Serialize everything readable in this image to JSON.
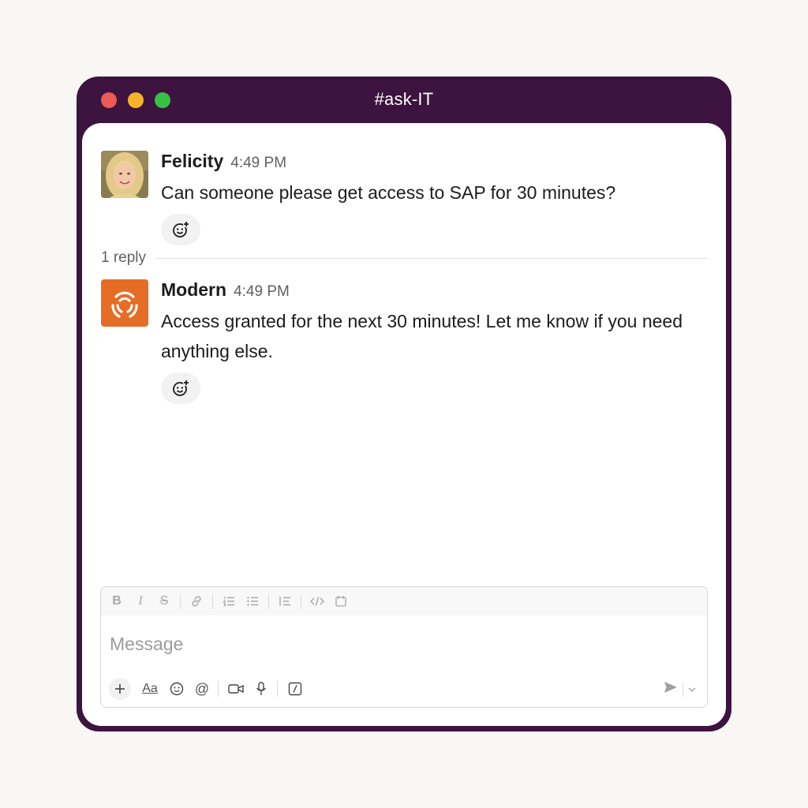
{
  "window": {
    "title": "#ask-IT",
    "colors": {
      "frame": "#3d133f",
      "close": "#ee5a55",
      "minimize": "#f6b42b",
      "maximize": "#37c046"
    }
  },
  "messages": [
    {
      "author": "Felicity",
      "time": "4:49 PM",
      "text": "Can someone please get access to SAP for 30 minutes?",
      "avatar": "felicity-photo"
    },
    {
      "author": "Modern",
      "time": "4:49 PM",
      "text": "Access granted for the next 30 minutes! Let me know if you need anything else.",
      "avatar": "modern-logo",
      "avatar_color": "#e56d25"
    }
  ],
  "thread": {
    "reply_count_label": "1 reply"
  },
  "composer": {
    "placeholder": "Message",
    "format_toolbar": [
      "bold-icon",
      "italic-icon",
      "strikethrough-icon",
      "link-icon",
      "ordered-list-icon",
      "bulleted-list-icon",
      "blockquote-icon",
      "code-icon",
      "code-block-icon"
    ],
    "format_labels": {
      "bold": "B",
      "italic": "I",
      "strike": "S"
    },
    "bottom_toolbar": [
      "plus-icon",
      "text-format-icon",
      "emoji-icon",
      "mention-icon",
      "video-icon",
      "microphone-icon",
      "slash-command-icon",
      "send-icon",
      "chevron-down-icon"
    ],
    "text_format_label": "Aa",
    "mention_label": "@"
  }
}
